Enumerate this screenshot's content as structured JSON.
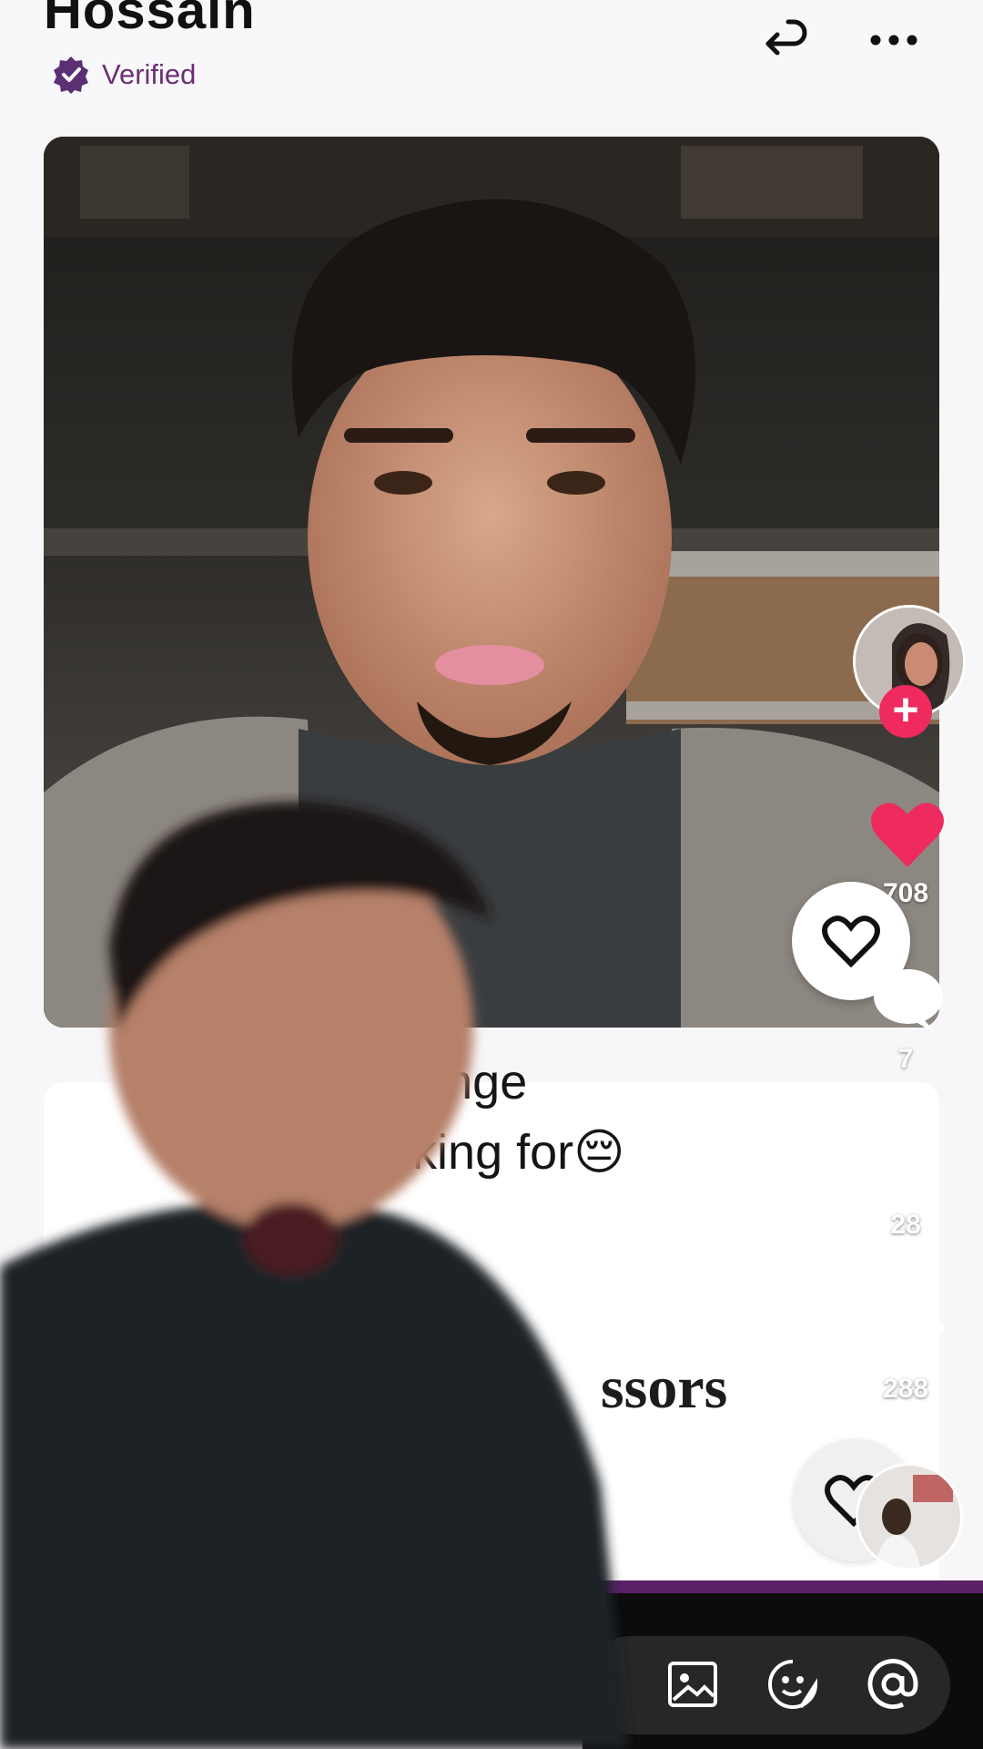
{
  "profile": {
    "name": "Hossain",
    "verified_label": "Verified"
  },
  "prompt": {
    "line1": "ve on hinge",
    "line2": "ski looking for😔",
    "line3": "ssors"
  },
  "rail": {
    "likes": "708",
    "comments": "7",
    "saves": "28",
    "shares": "288"
  },
  "colors": {
    "accent_purple": "#5b2167",
    "like_red": "#ef2a5e",
    "verified_purple": "#6b2f73"
  },
  "icons": {
    "verified": "verified-badge-icon",
    "undo": "undo-arrow-icon",
    "more": "more-icon",
    "like": "heart-icon",
    "comment": "comment-icon",
    "save": "bookmark-icon",
    "share": "share-arrow-icon",
    "image": "image-icon",
    "sticker": "sticker-icon",
    "mention": "at-icon"
  }
}
